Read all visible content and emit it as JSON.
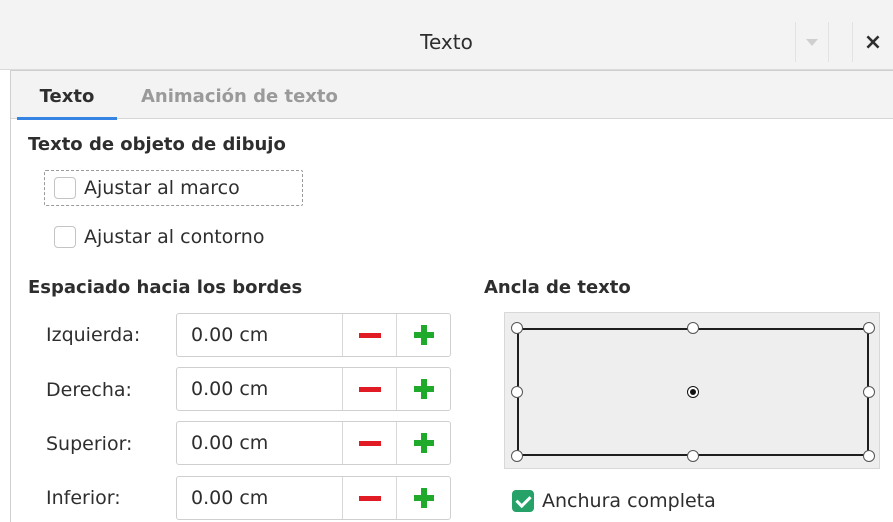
{
  "window": {
    "title": "Texto",
    "menu_icon": "chevron-down-icon",
    "close_label": "×"
  },
  "tabs": [
    {
      "label": "Texto",
      "active": true
    },
    {
      "label": "Animación de texto",
      "active": false
    }
  ],
  "drawing_text": {
    "heading": "Texto de objeto de dibujo",
    "fit_frame": {
      "label": "Ajustar al marco",
      "checked": false
    },
    "fit_contour": {
      "label": "Ajustar al contorno",
      "checked": false
    }
  },
  "spacing": {
    "heading": "Espaciado hacia los bordes",
    "rows": [
      {
        "label": "Izquierda:",
        "value": "0.00 cm"
      },
      {
        "label": "Derecha:",
        "value": "0.00 cm"
      },
      {
        "label": "Superior:",
        "value": "0.00 cm"
      },
      {
        "label": "Inferior:",
        "value": "0.00 cm"
      }
    ]
  },
  "anchor": {
    "heading": "Ancla de texto",
    "selected": "center",
    "full_width": {
      "label": "Anchura completa",
      "checked": true
    }
  },
  "colors": {
    "accent": "#3584e4",
    "minus": "#e01b24",
    "plus": "#1faa2c",
    "checked": "#26a269"
  }
}
